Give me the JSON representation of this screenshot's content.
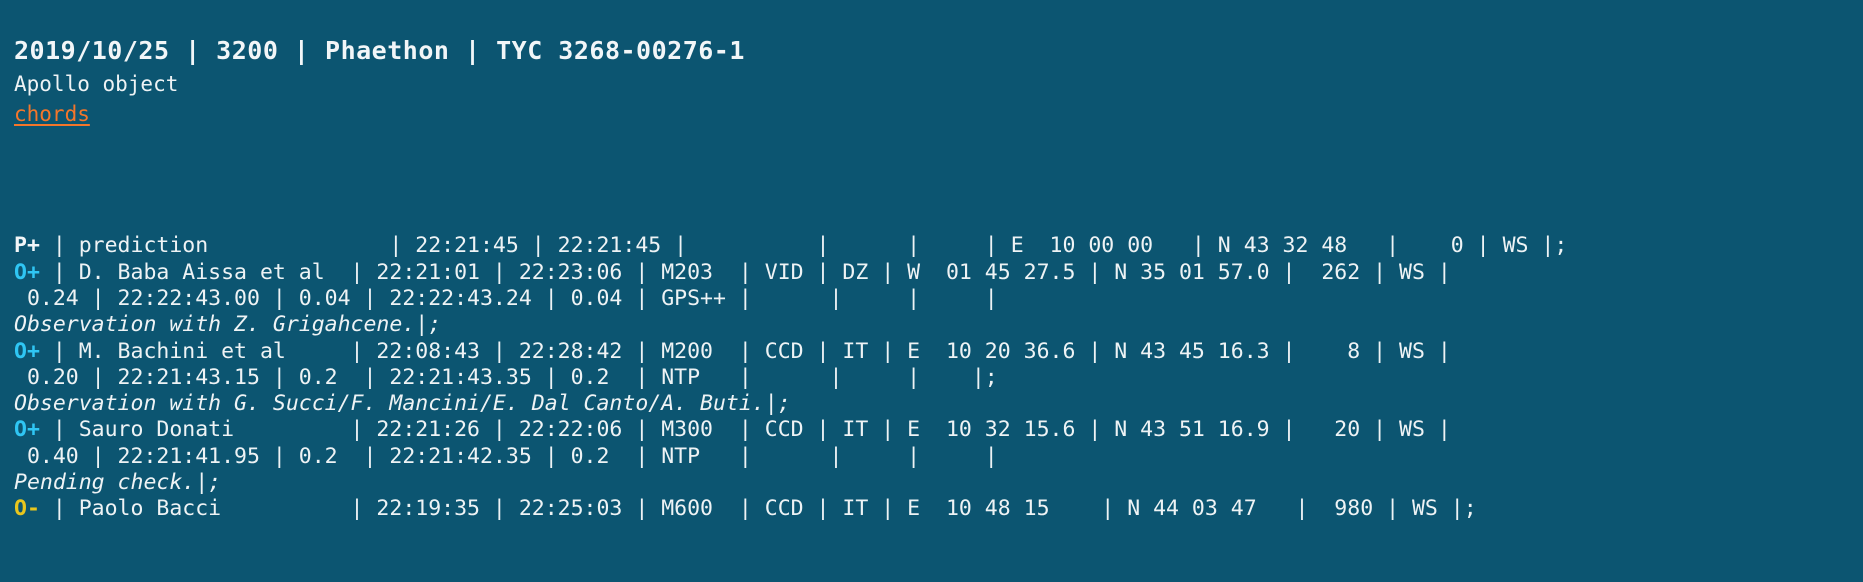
{
  "header": {
    "title": "2019/10/25 | 3200 | Phaethon | TYC 3268-00276-1",
    "object_class": "Apollo object",
    "chords_link": "chords"
  },
  "colors": {
    "background": "#0c5571",
    "text": "#eef3f5",
    "link": "#f4762a",
    "positive_flag": "#2fc6f4",
    "negative_flag": "#e8c61d",
    "prediction_flag": "#f2f6f8"
  },
  "records": [
    {
      "flag": "P+",
      "flag_kind": "prediction",
      "main": " | prediction              | 22:21:45 | 22:21:45 |          |      |     | E  10 00 00   | N 43 32 48   |    0 | WS |;",
      "detail": null,
      "note": null
    },
    {
      "flag": "O+",
      "flag_kind": "positive",
      "main": " | D. Baba Aissa et al  | 22:21:01 | 22:23:06 | M203  | VID | DZ | W  01 45 27.5 | N 35 01 57.0 |  262 | WS |",
      "detail": " 0.24 | 22:22:43.00 | 0.04 | 22:22:43.24 | 0.04 | GPS++ |      |     |     |",
      "note": "Observation with Z. Grigahcene.|;"
    },
    {
      "flag": "O+",
      "flag_kind": "positive",
      "main": " | M. Bachini et al     | 22:08:43 | 22:28:42 | M200  | CCD | IT | E  10 20 36.6 | N 43 45 16.3 |    8 | WS |",
      "detail": " 0.20 | 22:21:43.15 | 0.2  | 22:21:43.35 | 0.2  | NTP   |      |     |    |;",
      "note": "Observation with G. Succi/F. Mancini/E. Dal Canto/A. Buti.|;"
    },
    {
      "flag": "O+",
      "flag_kind": "positive",
      "main": " | Sauro Donati         | 22:21:26 | 22:22:06 | M300  | CCD | IT | E  10 32 15.6 | N 43 51 16.9 |   20 | WS |",
      "detail": " 0.40 | 22:21:41.95 | 0.2  | 22:21:42.35 | 0.2  | NTP   |      |     |     |",
      "note": "Pending check.|;"
    },
    {
      "flag": "O-",
      "flag_kind": "negative",
      "main": " | Paolo Bacci          | 22:19:35 | 22:25:03 | M600  | CCD | IT | E  10 48 15    | N 44 03 47   |  980 | WS |;",
      "detail": null,
      "note": null
    }
  ]
}
